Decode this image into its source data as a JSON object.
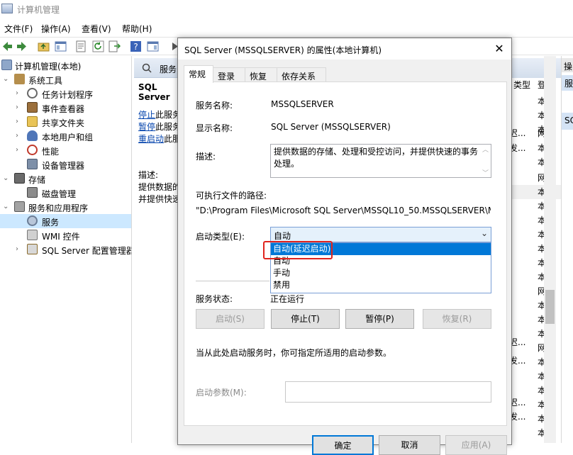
{
  "window": {
    "title": "计算机管理"
  },
  "menu": [
    "文件(F)",
    "操作(A)",
    "查看(V)",
    "帮助(H)"
  ],
  "tree": {
    "items": [
      {
        "label": "计算机管理(本地)"
      },
      {
        "label": "系统工具"
      },
      {
        "label": "任务计划程序"
      },
      {
        "label": "事件查看器"
      },
      {
        "label": "共享文件夹"
      },
      {
        "label": "本地用户和组"
      },
      {
        "label": "性能"
      },
      {
        "label": "设备管理器"
      },
      {
        "label": "存储"
      },
      {
        "label": "磁盘管理"
      },
      {
        "label": "服务和应用程序"
      },
      {
        "label": "服务"
      },
      {
        "label": "WMI 控件"
      },
      {
        "label": "SQL Server 配置管理器"
      }
    ]
  },
  "services_pane": {
    "header": "服务",
    "title": "SQL Server",
    "stop_link": "停止",
    "pause_link": "暂停",
    "restart_link": "重启动",
    "link_suffix": "此服务",
    "desc_label": "描述:",
    "desc_line1": "提供数据的",
    "desc_line2": "并提供快速"
  },
  "list_right": {
    "col_type": "类型",
    "col_logon": "登",
    "cells": [
      "本",
      "本",
      "本",
      "网",
      "本",
      "本",
      "本",
      "网",
      "本",
      "本",
      "本",
      "本",
      "本",
      "本",
      "本",
      "网",
      "本",
      "本",
      "本",
      "网",
      "本",
      "本",
      "本",
      "本",
      "本",
      "本",
      "本"
    ],
    "text_cells": [
      "迟...",
      "发...",
      "发...",
      "迟...",
      "发...",
      "迟...",
      "发..."
    ]
  },
  "actions_pane": {
    "header": "操",
    "item": "服",
    "item2": "SC"
  },
  "dialog": {
    "title": "SQL Server (MSSQLSERVER) 的属性(本地计算机)",
    "close": "✕",
    "tabs": [
      "常规",
      "登录",
      "恢复",
      "依存关系"
    ],
    "service_name_label": "服务名称:",
    "service_name": "MSSQLSERVER",
    "display_name_label": "显示名称:",
    "display_name": "SQL Server (MSSQLSERVER)",
    "desc_label": "描述:",
    "description_line1": "提供数据的存储、处理和受控访问，并提供快速的事务",
    "description_line2": "处理。",
    "path_label": "可执行文件的路径:",
    "path": "\"D:\\Program Files\\Microsoft SQL Server\\MSSQL10_50.MSSQLSERVER\\M",
    "startup_label": "启动类型(E):",
    "startup_selected": "自动",
    "startup_options": [
      "自动(延迟启动)",
      "自动",
      "手动",
      "禁用"
    ],
    "status_label": "服务状态:",
    "status_value": "正在运行",
    "buttons": {
      "start": "启动(S)",
      "stop": "停止(T)",
      "pause": "暂停(P)",
      "resume": "恢复(R)"
    },
    "hint": "当从此处启动服务时，你可指定所适用的启动参数。",
    "params_label": "启动参数(M):",
    "params_value": "",
    "footer": {
      "ok": "确定",
      "cancel": "取消",
      "apply": "应用(A)"
    }
  }
}
